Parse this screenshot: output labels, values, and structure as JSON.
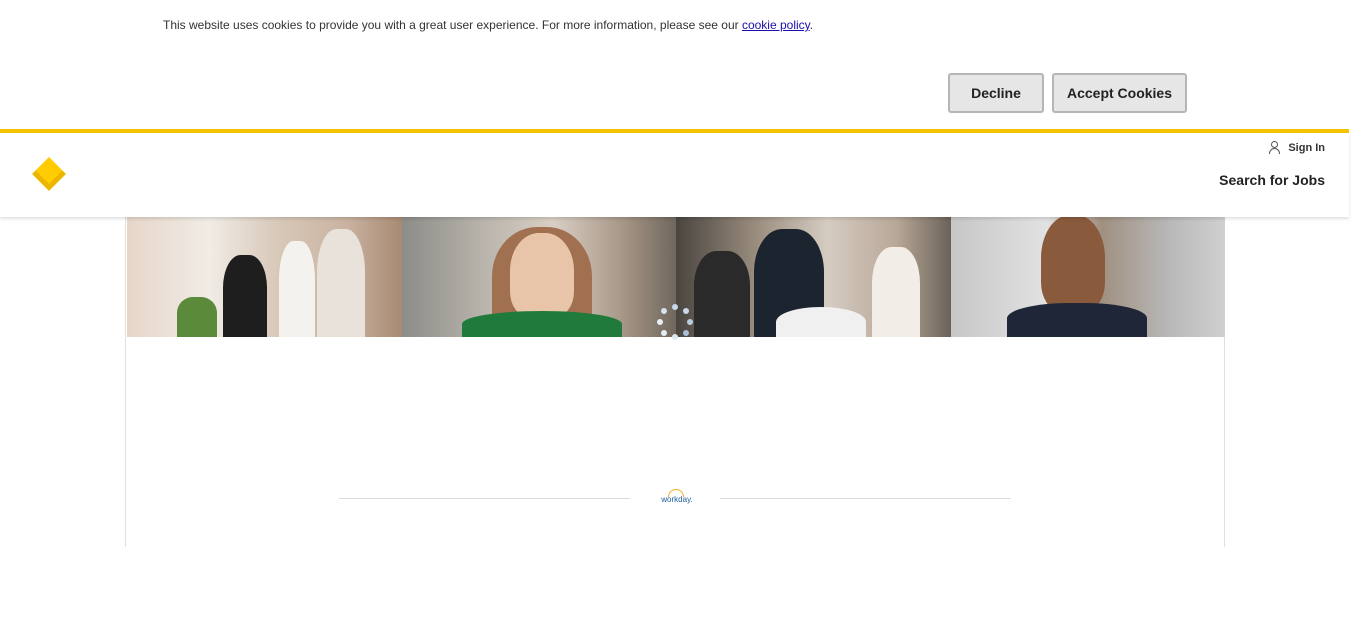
{
  "cookie_banner": {
    "message": "This website uses cookies to provide you with a great user experience. For more information, please see our ",
    "policy_link": "cookie policy",
    "message_end": ".",
    "decline_label": "Decline",
    "accept_label": "Accept Cookies"
  },
  "header": {
    "logo_icon": "commbank-diamond-logo",
    "signin_label": "Sign In",
    "signin_icon": "person-icon",
    "search_jobs_label": "Search for Jobs"
  },
  "colors": {
    "brand_yellow": "#f5c400",
    "workday_blue": "#1b5e9e",
    "workday_orange": "#f2a81d"
  },
  "footer": {
    "workday_logo_text": "workday."
  }
}
